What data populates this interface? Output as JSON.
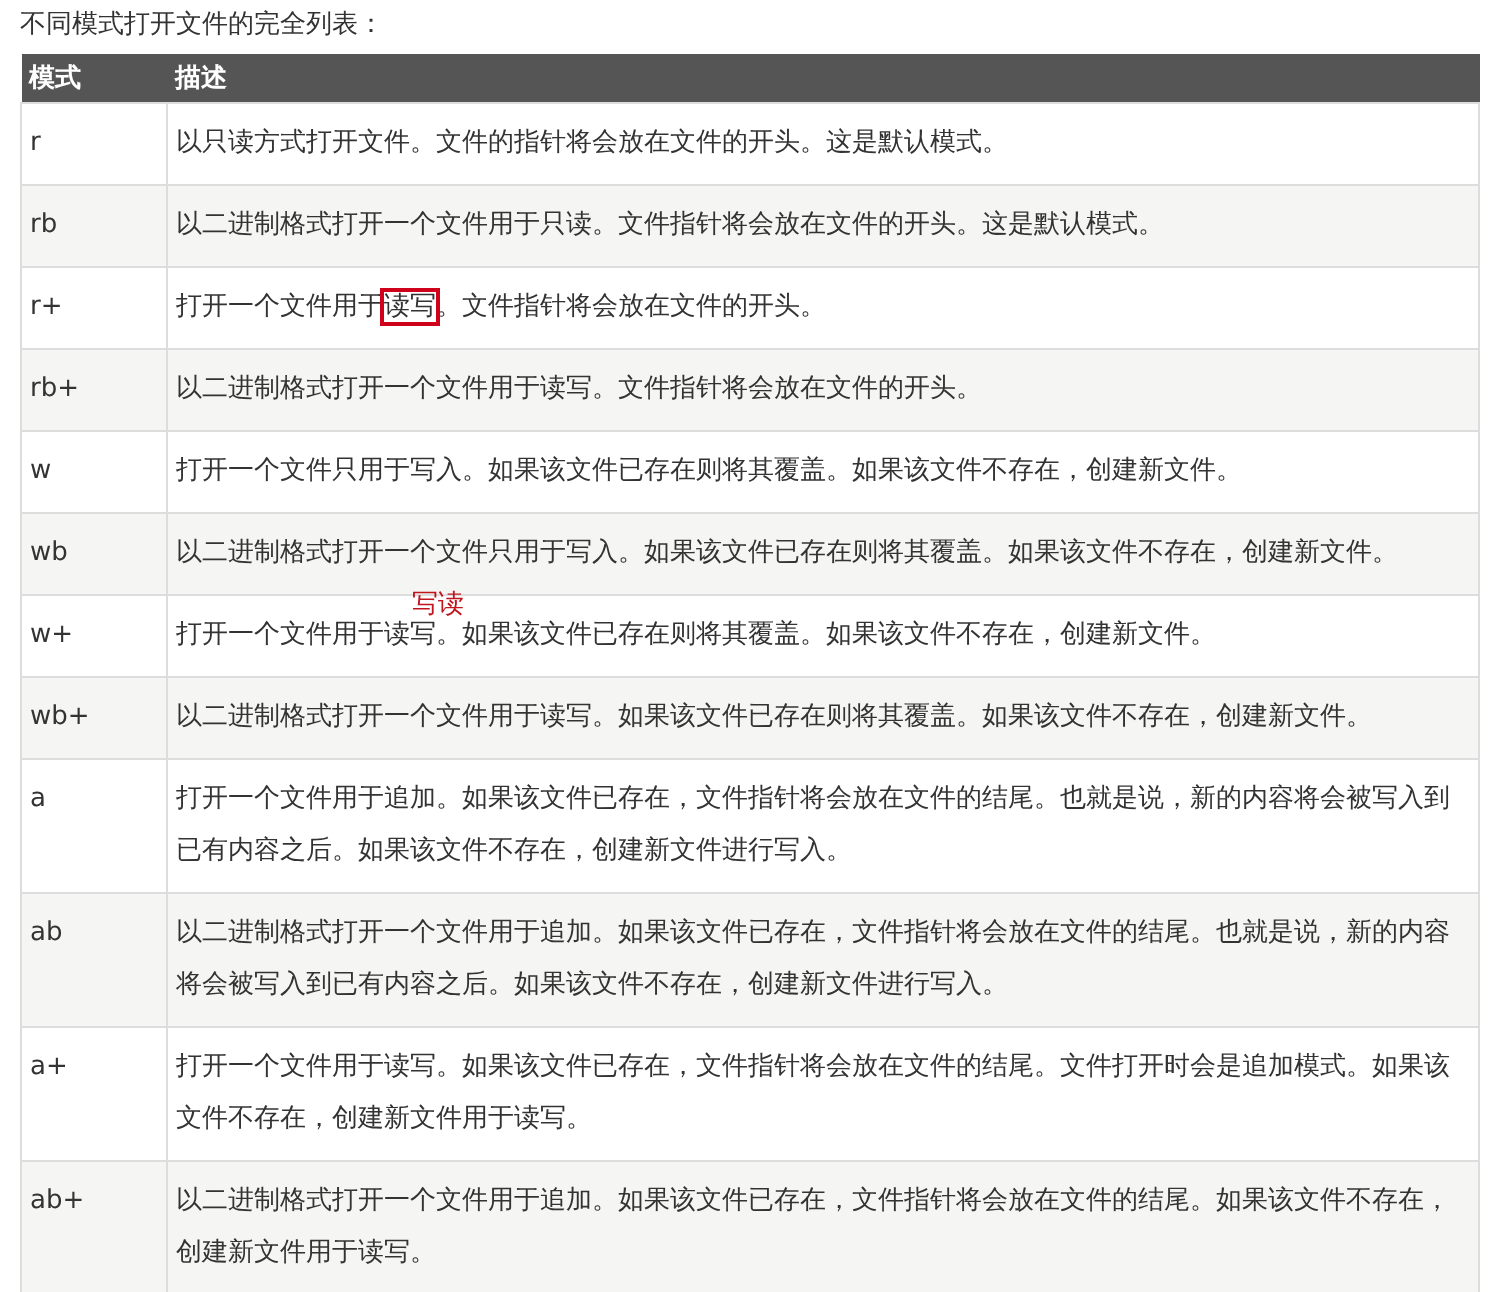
{
  "intro": "不同模式打开文件的完全列表：",
  "table": {
    "columns": [
      "模式",
      "描述"
    ],
    "rows": [
      {
        "mode": "r",
        "description": [
          {
            "text": "以只读方式打开文件。文件的指针将会放在文件的开头。这是默认模式。",
            "boxed": false
          }
        ]
      },
      {
        "mode": "rb",
        "description": [
          {
            "text": "以二进制格式打开一个文件用于只读。文件指针将会放在文件的开头。这是默认模式。",
            "boxed": false
          }
        ]
      },
      {
        "mode": "r+",
        "description": [
          {
            "text": "打开一个文件用于",
            "boxed": false
          },
          {
            "text": "读写",
            "boxed": true
          },
          {
            "text": "。文件指针将会放在文件的开头。",
            "boxed": false
          }
        ]
      },
      {
        "mode": "rb+",
        "description": [
          {
            "text": "以二进制格式打开一个文件用于读写。文件指针将会放在文件的开头。",
            "boxed": false
          }
        ]
      },
      {
        "mode": "w",
        "description": [
          {
            "text": "打开一个文件只用于写入。如果该文件已存在则将其覆盖。如果该文件不存在，创建新文件。",
            "boxed": false
          }
        ]
      },
      {
        "mode": "wb",
        "description": [
          {
            "text": "以二进制格式打开一个文件只用于写入。如果该文件已存在则将其覆盖。如果该文件不存在，创建新文件。",
            "boxed": false
          }
        ]
      },
      {
        "mode": "w+",
        "annotation": "写读",
        "description": [
          {
            "text": "打开一个文件用于读写。如果该文件已存在则将其覆盖。如果该文件不存在，创建新文件。",
            "boxed": false
          }
        ]
      },
      {
        "mode": "wb+",
        "description": [
          {
            "text": "以二进制格式打开一个文件用于读写。如果该文件已存在则将其覆盖。如果该文件不存在，创建新文件。",
            "boxed": false
          }
        ]
      },
      {
        "mode": "a",
        "description": [
          {
            "text": "打开一个文件用于追加。如果该文件已存在，文件指针将会放在文件的结尾。也就是说，新的内容将会被写入到已有内容之后。如果该文件不存在，创建新文件进行写入。",
            "boxed": false
          }
        ]
      },
      {
        "mode": "ab",
        "description": [
          {
            "text": "以二进制格式打开一个文件用于追加。如果该文件已存在，文件指针将会放在文件的结尾。也就是说，新的内容将会被写入到已有内容之后。如果该文件不存在，创建新文件进行写入。",
            "boxed": false
          }
        ]
      },
      {
        "mode": "a+",
        "description": [
          {
            "text": "打开一个文件用于读写。如果该文件已存在，文件指针将会放在文件的结尾。文件打开时会是追加模式。如果该文件不存在，创建新文件用于读写。",
            "boxed": false
          }
        ]
      },
      {
        "mode": "ab+",
        "description": [
          {
            "text": "以二进制格式打开一个文件用于追加。如果该文件已存在，文件指针将会放在文件的结尾。如果该文件不存在，创建新文件用于读写。",
            "boxed": false
          }
        ]
      }
    ]
  }
}
